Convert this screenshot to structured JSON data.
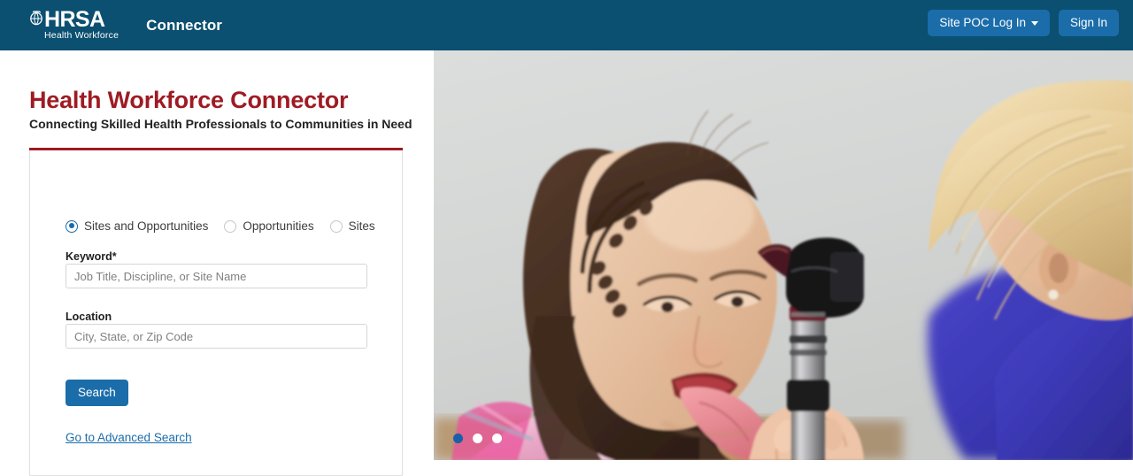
{
  "header": {
    "logo": {
      "icon": "hrsa-seal-icon",
      "primary": "HRSA",
      "secondary": "Health Workforce"
    },
    "app_name": "Connector",
    "background_color": "#0b4f71",
    "buttons": [
      {
        "label": "Site POC Log In",
        "has_caret": true,
        "name": "site-poc-login-button"
      },
      {
        "label": "Sign In",
        "has_caret": false,
        "name": "sign-in-button"
      }
    ],
    "button_color": "#1b6daa"
  },
  "hero": {
    "title": "Health Workforce Connector",
    "title_color": "#9e1b23",
    "subtitle": "Connecting Skilled Health Professionals to Communities in Need",
    "rule_color": "#9e1b23"
  },
  "search_card": {
    "search_type": {
      "options": [
        {
          "label": "Sites and Opportunities",
          "selected": true
        },
        {
          "label": "Opportunities",
          "selected": false
        },
        {
          "label": "Sites",
          "selected": false
        }
      ],
      "selected_color": "#1a6ba8"
    },
    "keyword": {
      "label": "Keyword*",
      "value": "",
      "placeholder": "Job Title, Discipline, or Site Name"
    },
    "location": {
      "label": "Location",
      "value": "",
      "placeholder": "City, State, or Zip Code"
    },
    "search_button": {
      "label": "Search",
      "color": "#1b6daa"
    },
    "advanced_search_link": "Go to Advanced Search"
  },
  "carousel": {
    "slide_count": 3,
    "active_index": 0,
    "active_color": "#1761a8",
    "inactive_color": "#ffffff",
    "image_description": "A young girl with braided hair sticking out her tongue while a blonde clinician in blue scrubs holds an otoscope"
  }
}
